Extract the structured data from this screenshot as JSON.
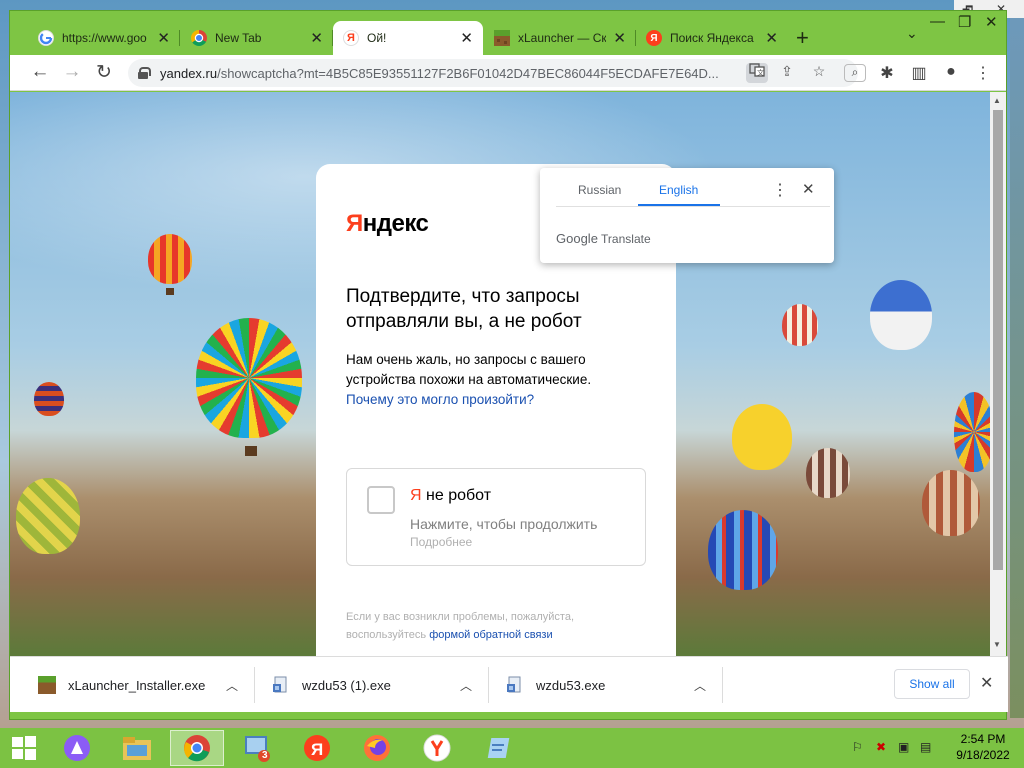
{
  "desktop": {
    "corner_icons": [
      "🗗",
      "✕"
    ]
  },
  "tabs": [
    {
      "title": "https://www.goo",
      "favicon": "google-icon",
      "color": "#ffffff"
    },
    {
      "title": "New Tab",
      "favicon": "chrome-icon",
      "color": "#ffffff"
    },
    {
      "title": "Ой!",
      "favicon": "yandex-icon",
      "color": "#fc3f1d",
      "active": true
    },
    {
      "title": "xLauncher — Ск",
      "favicon": "minecraft-icon",
      "color": "#5b8731"
    },
    {
      "title": "Поиск Яндекса",
      "favicon": "yandex-icon",
      "color": "#fc3f1d"
    }
  ],
  "new_tab_glyph": "+",
  "window_controls": {
    "tab_search": "⌄",
    "minimize": "—",
    "maximize": "❐",
    "close": "✕"
  },
  "toolbar": {
    "url_host": "yandex.ru",
    "url_path": "/showcaptcha?mt=4B5C85E93551127F2B6F01042D47BEC86044F5ECDAFE7E64D...",
    "icons": [
      "translate-icon",
      "share-icon",
      "star-icon",
      "lens-icon",
      "extensions-icon",
      "sidepanel-icon",
      "profile-icon",
      "menu-icon"
    ]
  },
  "translate_popup": {
    "lang_from": "Russian",
    "lang_to": "English",
    "brand_google": "Google",
    "brand_translate": "Translate"
  },
  "captcha_page": {
    "logo_first": "Я",
    "logo_rest": "ндекс",
    "heading": "Подтвердите, что запросы отправляли вы, а не робот",
    "description": "Нам очень жаль, но запросы с вашего устройства похожи на автоматические.",
    "why_link": "Почему это могло произойти?",
    "not_robot_first": "Я",
    "not_robot_rest": "не робот",
    "click_hint": "Нажмите, чтобы продолжить",
    "more": "Подробнее",
    "problem_text": "Если у вас возникли проблемы, пожалуйста, воспользуйтесь",
    "feedback_link": "формой обратной связи"
  },
  "downloads": {
    "items": [
      {
        "name": "xLauncher_Installer.exe"
      },
      {
        "name": "wzdu53 (1).exe"
      },
      {
        "name": "wzdu53.exe"
      }
    ],
    "show_all": "Show all"
  },
  "taskbar": {
    "time": "2:54 PM",
    "date": "9/18/2022",
    "badge": "3",
    "apps": [
      "windows-start-icon",
      "alice-icon",
      "explorer-icon",
      "chrome-icon",
      "task-manager-icon",
      "yandex-icon",
      "firefox-icon",
      "yandex-browser-icon",
      "notepad-icon"
    ]
  },
  "colors": {
    "yandex_red": "#fc3f1d",
    "link_blue": "#1a50b0",
    "chrome_blue": "#1a73e8",
    "window_green": "#7ec544"
  }
}
